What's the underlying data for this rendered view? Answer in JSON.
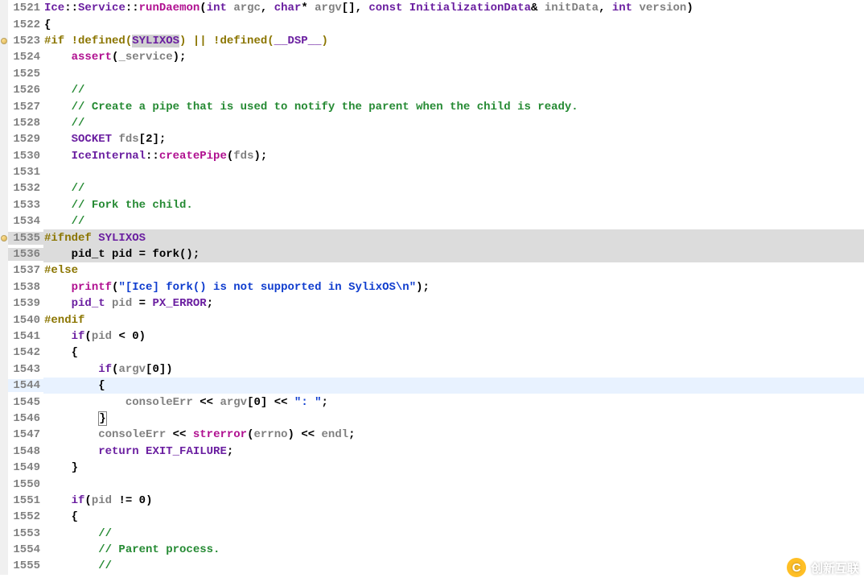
{
  "file": {
    "function_signature": "Ice::Service::runDaemon(int argc, char* argv[], const InitializationData& initData, int version)"
  },
  "watermark": {
    "text": "创新互联",
    "badge": "C"
  },
  "lines": [
    {
      "n": "1521",
      "marker": false,
      "hl": "",
      "tokens": [
        {
          "c": "t-type",
          "t": "Ice"
        },
        {
          "c": "t-punc",
          "t": "::"
        },
        {
          "c": "t-type",
          "t": "Service"
        },
        {
          "c": "t-punc",
          "t": "::"
        },
        {
          "c": "t-call",
          "t": "runDaemon"
        },
        {
          "c": "t-punc",
          "t": "("
        },
        {
          "c": "t-kw",
          "t": "int"
        },
        {
          "c": "t-white",
          "t": " "
        },
        {
          "c": "t-ident",
          "t": "argc"
        },
        {
          "c": "t-punc",
          "t": ", "
        },
        {
          "c": "t-kw",
          "t": "char"
        },
        {
          "c": "t-punc",
          "t": "* "
        },
        {
          "c": "t-ident",
          "t": "argv"
        },
        {
          "c": "t-punc",
          "t": "[], "
        },
        {
          "c": "t-kw",
          "t": "const"
        },
        {
          "c": "t-white",
          "t": " "
        },
        {
          "c": "t-type",
          "t": "InitializationData"
        },
        {
          "c": "t-punc",
          "t": "& "
        },
        {
          "c": "t-ident",
          "t": "initData"
        },
        {
          "c": "t-punc",
          "t": ", "
        },
        {
          "c": "t-kw",
          "t": "int"
        },
        {
          "c": "t-white",
          "t": " "
        },
        {
          "c": "t-ident",
          "t": "version"
        },
        {
          "c": "t-punc",
          "t": ")"
        }
      ]
    },
    {
      "n": "1522",
      "marker": false,
      "hl": "",
      "tokens": [
        {
          "c": "t-punc",
          "t": "{"
        }
      ]
    },
    {
      "n": "1523",
      "marker": true,
      "hl": "",
      "tokens": [
        {
          "c": "t-pre",
          "t": "#if "
        },
        {
          "c": "t-pre",
          "t": "!defined("
        },
        {
          "c": "t-macro t-enc",
          "t": "SYLIXOS"
        },
        {
          "c": "t-pre",
          "t": ") || !defined("
        },
        {
          "c": "t-macro",
          "t": "__DSP__"
        },
        {
          "c": "t-pre",
          "t": ")"
        }
      ]
    },
    {
      "n": "1524",
      "marker": false,
      "hl": "",
      "tokens": [
        {
          "c": "t-white",
          "t": "    "
        },
        {
          "c": "t-call",
          "t": "assert"
        },
        {
          "c": "t-punc",
          "t": "("
        },
        {
          "c": "t-ident",
          "t": "_service"
        },
        {
          "c": "t-punc",
          "t": ");"
        }
      ]
    },
    {
      "n": "1525",
      "marker": false,
      "hl": "",
      "tokens": []
    },
    {
      "n": "1526",
      "marker": false,
      "hl": "",
      "tokens": [
        {
          "c": "t-white",
          "t": "    "
        },
        {
          "c": "t-comment",
          "t": "//"
        }
      ]
    },
    {
      "n": "1527",
      "marker": false,
      "hl": "",
      "tokens": [
        {
          "c": "t-white",
          "t": "    "
        },
        {
          "c": "t-comment",
          "t": "// Create a pipe that is used to notify the parent when the child is ready."
        }
      ]
    },
    {
      "n": "1528",
      "marker": false,
      "hl": "",
      "tokens": [
        {
          "c": "t-white",
          "t": "    "
        },
        {
          "c": "t-comment",
          "t": "//"
        }
      ]
    },
    {
      "n": "1529",
      "marker": false,
      "hl": "",
      "tokens": [
        {
          "c": "t-white",
          "t": "    "
        },
        {
          "c": "t-type",
          "t": "SOCKET"
        },
        {
          "c": "t-white",
          "t": " "
        },
        {
          "c": "t-ident",
          "t": "fds"
        },
        {
          "c": "t-punc",
          "t": "["
        },
        {
          "c": "t-num",
          "t": "2"
        },
        {
          "c": "t-punc",
          "t": "];"
        }
      ]
    },
    {
      "n": "1530",
      "marker": false,
      "hl": "",
      "tokens": [
        {
          "c": "t-white",
          "t": "    "
        },
        {
          "c": "t-type",
          "t": "IceInternal"
        },
        {
          "c": "t-punc",
          "t": "::"
        },
        {
          "c": "t-call",
          "t": "createPipe"
        },
        {
          "c": "t-punc",
          "t": "("
        },
        {
          "c": "t-ident",
          "t": "fds"
        },
        {
          "c": "t-punc",
          "t": ");"
        }
      ]
    },
    {
      "n": "1531",
      "marker": false,
      "hl": "",
      "tokens": []
    },
    {
      "n": "1532",
      "marker": false,
      "hl": "",
      "tokens": [
        {
          "c": "t-white",
          "t": "    "
        },
        {
          "c": "t-comment",
          "t": "//"
        }
      ]
    },
    {
      "n": "1533",
      "marker": false,
      "hl": "",
      "tokens": [
        {
          "c": "t-white",
          "t": "    "
        },
        {
          "c": "t-comment",
          "t": "// Fork the child."
        }
      ]
    },
    {
      "n": "1534",
      "marker": false,
      "hl": "",
      "tokens": [
        {
          "c": "t-white",
          "t": "    "
        },
        {
          "c": "t-comment",
          "t": "//"
        }
      ]
    },
    {
      "n": "1535",
      "marker": true,
      "hl": "grey",
      "tokens": [
        {
          "c": "t-pre",
          "t": "#ifndef "
        },
        {
          "c": "t-macro",
          "t": "SYLIXOS"
        }
      ]
    },
    {
      "n": "1536",
      "marker": false,
      "hl": "grey",
      "tokens": [
        {
          "c": "t-white",
          "t": "    "
        },
        {
          "c": "t-func",
          "t": "pid_t pid = fork();"
        }
      ]
    },
    {
      "n": "1537",
      "marker": false,
      "hl": "",
      "tokens": [
        {
          "c": "t-pre",
          "t": "#else"
        }
      ]
    },
    {
      "n": "1538",
      "marker": false,
      "hl": "",
      "tokens": [
        {
          "c": "t-white",
          "t": "    "
        },
        {
          "c": "t-call",
          "t": "printf"
        },
        {
          "c": "t-punc",
          "t": "("
        },
        {
          "c": "t-str",
          "t": "\"[Ice] fork() is not supported in SylixOS\\n\""
        },
        {
          "c": "t-punc",
          "t": ");"
        }
      ]
    },
    {
      "n": "1539",
      "marker": false,
      "hl": "",
      "tokens": [
        {
          "c": "t-white",
          "t": "    "
        },
        {
          "c": "t-type",
          "t": "pid_t"
        },
        {
          "c": "t-white",
          "t": " "
        },
        {
          "c": "t-ident",
          "t": "pid"
        },
        {
          "c": "t-white",
          "t": " "
        },
        {
          "c": "t-op",
          "t": "="
        },
        {
          "c": "t-white",
          "t": " "
        },
        {
          "c": "t-const",
          "t": "PX_ERROR"
        },
        {
          "c": "t-punc",
          "t": ";"
        }
      ]
    },
    {
      "n": "1540",
      "marker": false,
      "hl": "",
      "tokens": [
        {
          "c": "t-pre",
          "t": "#endif"
        }
      ]
    },
    {
      "n": "1541",
      "marker": false,
      "hl": "",
      "tokens": [
        {
          "c": "t-white",
          "t": "    "
        },
        {
          "c": "t-kw",
          "t": "if"
        },
        {
          "c": "t-punc",
          "t": "("
        },
        {
          "c": "t-ident",
          "t": "pid"
        },
        {
          "c": "t-white",
          "t": " "
        },
        {
          "c": "t-op",
          "t": "<"
        },
        {
          "c": "t-white",
          "t": " "
        },
        {
          "c": "t-num",
          "t": "0"
        },
        {
          "c": "t-punc",
          "t": ")"
        }
      ]
    },
    {
      "n": "1542",
      "marker": false,
      "hl": "",
      "tokens": [
        {
          "c": "t-white",
          "t": "    "
        },
        {
          "c": "t-punc",
          "t": "{"
        }
      ]
    },
    {
      "n": "1543",
      "marker": false,
      "hl": "",
      "tokens": [
        {
          "c": "t-white",
          "t": "        "
        },
        {
          "c": "t-kw",
          "t": "if"
        },
        {
          "c": "t-punc",
          "t": "("
        },
        {
          "c": "t-ident",
          "t": "argv"
        },
        {
          "c": "t-punc",
          "t": "["
        },
        {
          "c": "t-num",
          "t": "0"
        },
        {
          "c": "t-punc",
          "t": "])"
        }
      ]
    },
    {
      "n": "1544",
      "marker": false,
      "hl": "blue",
      "tokens": [
        {
          "c": "t-white",
          "t": "        "
        },
        {
          "c": "t-punc",
          "t": "{"
        }
      ]
    },
    {
      "n": "1545",
      "marker": false,
      "hl": "",
      "tokens": [
        {
          "c": "t-white",
          "t": "            "
        },
        {
          "c": "t-ident",
          "t": "consoleErr"
        },
        {
          "c": "t-white",
          "t": " "
        },
        {
          "c": "t-op",
          "t": "<<"
        },
        {
          "c": "t-white",
          "t": " "
        },
        {
          "c": "t-ident",
          "t": "argv"
        },
        {
          "c": "t-punc",
          "t": "["
        },
        {
          "c": "t-num",
          "t": "0"
        },
        {
          "c": "t-punc",
          "t": "]"
        },
        {
          "c": "t-white",
          "t": " "
        },
        {
          "c": "t-op",
          "t": "<<"
        },
        {
          "c": "t-white",
          "t": " "
        },
        {
          "c": "t-str",
          "t": "\": \""
        },
        {
          "c": "t-punc",
          "t": ";"
        }
      ]
    },
    {
      "n": "1546",
      "marker": false,
      "hl": "",
      "tokens": [
        {
          "c": "t-white",
          "t": "        "
        },
        {
          "c": "t-punc t-box",
          "t": "}"
        }
      ]
    },
    {
      "n": "1547",
      "marker": false,
      "hl": "",
      "tokens": [
        {
          "c": "t-white",
          "t": "        "
        },
        {
          "c": "t-ident",
          "t": "consoleErr"
        },
        {
          "c": "t-white",
          "t": " "
        },
        {
          "c": "t-op",
          "t": "<<"
        },
        {
          "c": "t-white",
          "t": " "
        },
        {
          "c": "t-call",
          "t": "strerror"
        },
        {
          "c": "t-punc",
          "t": "("
        },
        {
          "c": "t-ident",
          "t": "errno"
        },
        {
          "c": "t-punc",
          "t": ")"
        },
        {
          "c": "t-white",
          "t": " "
        },
        {
          "c": "t-op",
          "t": "<<"
        },
        {
          "c": "t-white",
          "t": " "
        },
        {
          "c": "t-ident",
          "t": "endl"
        },
        {
          "c": "t-punc",
          "t": ";"
        }
      ]
    },
    {
      "n": "1548",
      "marker": false,
      "hl": "",
      "tokens": [
        {
          "c": "t-white",
          "t": "        "
        },
        {
          "c": "t-kw",
          "t": "return"
        },
        {
          "c": "t-white",
          "t": " "
        },
        {
          "c": "t-const",
          "t": "EXIT_FAILURE"
        },
        {
          "c": "t-punc",
          "t": ";"
        }
      ]
    },
    {
      "n": "1549",
      "marker": false,
      "hl": "",
      "tokens": [
        {
          "c": "t-white",
          "t": "    "
        },
        {
          "c": "t-punc",
          "t": "}"
        }
      ]
    },
    {
      "n": "1550",
      "marker": false,
      "hl": "",
      "tokens": []
    },
    {
      "n": "1551",
      "marker": false,
      "hl": "",
      "tokens": [
        {
          "c": "t-white",
          "t": "    "
        },
        {
          "c": "t-kw",
          "t": "if"
        },
        {
          "c": "t-punc",
          "t": "("
        },
        {
          "c": "t-ident",
          "t": "pid"
        },
        {
          "c": "t-white",
          "t": " "
        },
        {
          "c": "t-op",
          "t": "!="
        },
        {
          "c": "t-white",
          "t": " "
        },
        {
          "c": "t-num",
          "t": "0"
        },
        {
          "c": "t-punc",
          "t": ")"
        }
      ]
    },
    {
      "n": "1552",
      "marker": false,
      "hl": "",
      "tokens": [
        {
          "c": "t-white",
          "t": "    "
        },
        {
          "c": "t-punc",
          "t": "{"
        }
      ]
    },
    {
      "n": "1553",
      "marker": false,
      "hl": "",
      "tokens": [
        {
          "c": "t-white",
          "t": "        "
        },
        {
          "c": "t-comment",
          "t": "//"
        }
      ]
    },
    {
      "n": "1554",
      "marker": false,
      "hl": "",
      "tokens": [
        {
          "c": "t-white",
          "t": "        "
        },
        {
          "c": "t-comment",
          "t": "// Parent process."
        }
      ]
    },
    {
      "n": "1555",
      "marker": false,
      "hl": "",
      "tokens": [
        {
          "c": "t-white",
          "t": "        "
        },
        {
          "c": "t-comment",
          "t": "//"
        }
      ]
    }
  ]
}
